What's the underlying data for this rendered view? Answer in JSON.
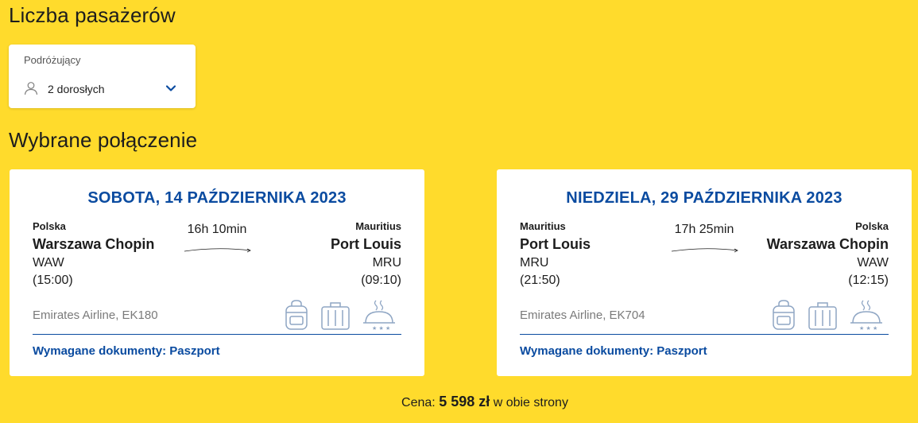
{
  "passengers_section": {
    "title": "Liczba pasażerów",
    "field_label": "Podróżujący",
    "value": "2 dorosłych"
  },
  "connection_section": {
    "title": "Wybrane połączenie"
  },
  "outbound": {
    "date": "SOBOTA, 14 PAŹDZIERNIKA 2023",
    "from": {
      "country": "Polska",
      "airport": "Warszawa Chopin",
      "code": "WAW",
      "time": "(15:00)"
    },
    "to": {
      "country": "Mauritius",
      "airport": "Port Louis",
      "code": "MRU",
      "time": "(09:10)"
    },
    "duration": "16h 10min",
    "airline": "Emirates Airline, EK180",
    "documents": "Wymagane dokumenty: Paszport"
  },
  "return": {
    "date": "NIEDZIELA, 29 PAŹDZIERNIKA 2023",
    "from": {
      "country": "Mauritius",
      "airport": "Port Louis",
      "code": "MRU",
      "time": "(21:50)"
    },
    "to": {
      "country": "Polska",
      "airport": "Warszawa Chopin",
      "code": "WAW",
      "time": "(12:15)"
    },
    "duration": "17h 25min",
    "airline": "Emirates Airline, EK704",
    "documents": "Wymagane dokumenty: Paszport"
  },
  "price": {
    "label": "Cena:",
    "amount": "5 598 zł",
    "suffix": "w obie strony"
  },
  "icons": {
    "user": "user-icon",
    "dropdown": "chevron-down-icon",
    "arrow": "flight-arrow-icon",
    "backpack": "backpack-icon",
    "suitcase": "suitcase-icon",
    "meal": "meal-icon"
  },
  "colors": {
    "background": "#ffdb2c",
    "accent": "#0a4ba0",
    "icon_muted": "#8fa6c4"
  }
}
